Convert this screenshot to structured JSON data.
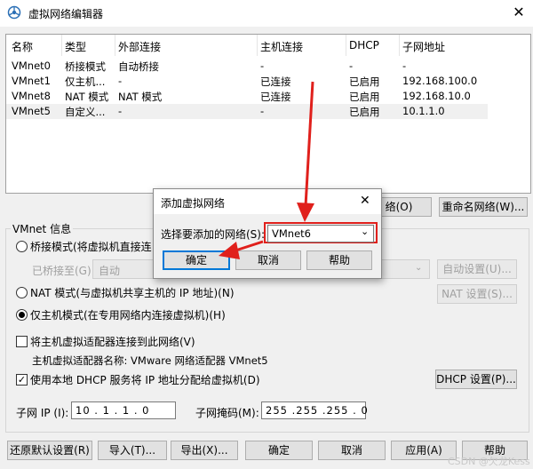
{
  "window": {
    "title": "虚拟网络编辑器",
    "close": "✕"
  },
  "list": {
    "columns": [
      "名称",
      "类型",
      "外部连接",
      "主机连接",
      "DHCP",
      "子网地址"
    ],
    "rows": [
      [
        "VMnet0",
        "桥接模式",
        "自动桥接",
        "-",
        "-",
        "-"
      ],
      [
        "VMnet1",
        "仅主机...",
        "-",
        "已连接",
        "已启用",
        "192.168.100.0"
      ],
      [
        "VMnet8",
        "NAT 模式",
        "NAT 模式",
        "已连接",
        "已启用",
        "192.168.10.0"
      ],
      [
        "VMnet5",
        "自定义...",
        "-",
        "-",
        "已启用",
        "10.1.1.0"
      ]
    ]
  },
  "list_buttons": {
    "add_partial": "络(O)",
    "rename": "重命名网络(W)..."
  },
  "vmnet_info": {
    "title": "VMnet 信息",
    "bridged": "桥接模式(将虚拟机直接连",
    "bridged_to": "已桥接至(G):",
    "bridged_to_value": "自动",
    "auto_settings": "自动设置(U)...",
    "nat": "NAT 模式(与虚拟机共享主机的 IP 地址)(N)",
    "nat_settings": "NAT 设置(S)...",
    "host_only": "仅主机模式(在专用网络内连接虚拟机)(H)",
    "connect_adapter": "将主机虚拟适配器连接到此网络(V)",
    "adapter_name": "主机虚拟适配器名称: VMware 网络适配器 VMnet5",
    "dhcp": "使用本地 DHCP 服务将 IP 地址分配给虚拟机(D)",
    "dhcp_settings": "DHCP 设置(P)...",
    "subnet_ip_label": "子网 IP (I):",
    "subnet_ip": "10 . 1 . 1 . 0",
    "subnet_mask_label": "子网掩码(M):",
    "subnet_mask": "255 .255 .255 . 0"
  },
  "bottom": {
    "restore": "还原默认设置(R)",
    "import": "导入(T)...",
    "export": "导出(X)...",
    "ok": "确定",
    "cancel": "取消",
    "apply": "应用(A)",
    "help": "帮助"
  },
  "dialog": {
    "title": "添加虚拟网络",
    "close": "✕",
    "select_label": "选择要添加的网络(S):",
    "selected": "VMnet6",
    "ok": "确定",
    "cancel": "取消",
    "help": "帮助"
  },
  "watermark": "CSDN @欠龙Kess",
  "colors": {
    "accent": "#e0201c",
    "selection": "#0078d7"
  }
}
